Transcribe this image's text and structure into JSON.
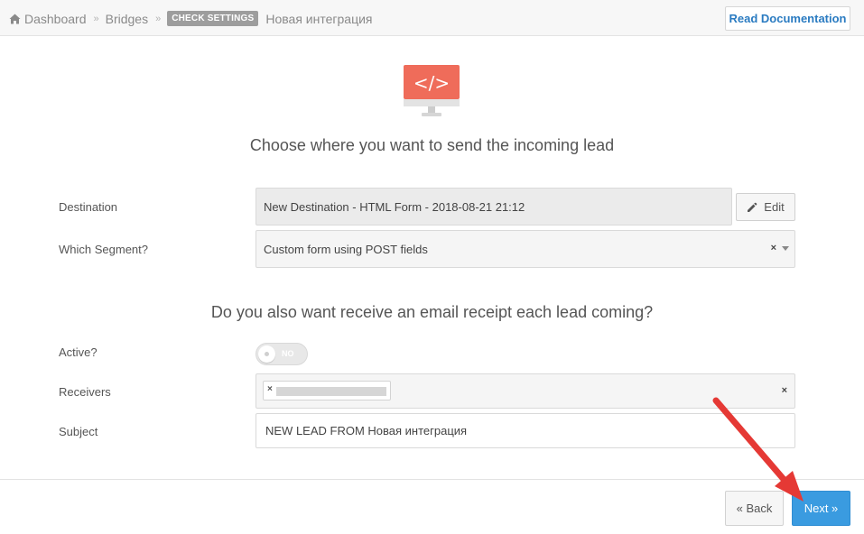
{
  "breadcrumb": {
    "home": "Dashboard",
    "section": "Bridges",
    "badge": "CHECK SETTINGS",
    "current": "Новая интеграция",
    "separator": "»"
  },
  "header": {
    "docs_button": "Read Documentation"
  },
  "hero": {
    "icon": "code-monitor-icon",
    "code_glyph": "</>",
    "title": "Choose where you want to send the incoming lead"
  },
  "destination": {
    "label": "Destination",
    "value": "New Destination - HTML Form - 2018-08-21 21:12",
    "edit_label": "Edit"
  },
  "segment": {
    "label": "Which Segment?",
    "value": "Custom form using POST fields",
    "clear": "×"
  },
  "email": {
    "title": "Do you also want receive an email receipt each lead coming?",
    "active_label": "Active?",
    "active_state": "NO",
    "receivers_label": "Receivers",
    "chip_remove": "×",
    "receivers_clear": "×",
    "subject_label": "Subject",
    "subject_value": "NEW LEAD FROM Новая интеграция"
  },
  "footer": {
    "back_label": "« Back",
    "next_label": "Next »"
  },
  "colors": {
    "accent": "#3a9be0",
    "link": "#2a7bc1",
    "monitor": "#ef6c5a",
    "annotation_arrow": "#e53935"
  }
}
